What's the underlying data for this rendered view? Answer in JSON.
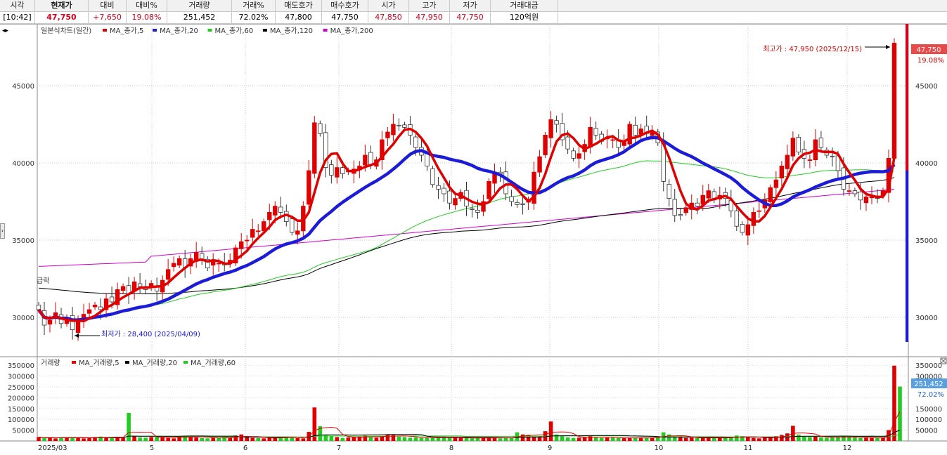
{
  "quote": {
    "headers": [
      "시각",
      "현재가",
      "대비",
      "대비%",
      "거래량",
      "거래%",
      "매도호가",
      "매수호가",
      "시가",
      "고가",
      "저가",
      "거래대금"
    ],
    "values": [
      "[10:42]",
      "47,750",
      "+7,650",
      "19.08%",
      "251,452",
      "72.02%",
      "47,800",
      "47,750",
      "47,850",
      "47,950",
      "47,750",
      "120억원"
    ]
  },
  "price_panel": {
    "legend_title": "일본식차트(일간)",
    "legend_items": [
      {
        "label": "MA_종가,5",
        "color": "#e00000"
      },
      {
        "label": "MA_종가,20",
        "color": "#1c1cd8"
      },
      {
        "label": "MA_종가,60",
        "color": "#22cc22"
      },
      {
        "label": "MA_종가,120",
        "color": "#000000"
      },
      {
        "label": "MA_종가,200",
        "color": "#d000d0"
      }
    ],
    "y_ticks": [
      "30000",
      "35000",
      "40000",
      "45000"
    ],
    "high_annotation": "최고가 : 47,950 (2025/12/15)",
    "low_annotation": "최저가 : 28,400 (2025/04/09)",
    "last_price_tag": "47,750",
    "last_change_tag": "19.08%",
    "side_text": "급락"
  },
  "volume_panel": {
    "legend_title": "거래량",
    "legend_items": [
      {
        "label": "MA_거래량,5",
        "color": "#e00000"
      },
      {
        "label": "MA_거래량,20",
        "color": "#000000"
      },
      {
        "label": "MA_거래량,60",
        "color": "#22cc22"
      }
    ],
    "y_ticks": [
      "50000",
      "100000",
      "150000",
      "200000",
      "250000",
      "300000",
      "350000"
    ],
    "right_ticks": [
      "50000",
      "100000",
      "150000",
      "300000",
      "350000"
    ],
    "last_volume_tag": "251,452",
    "last_ratio_tag": "72.02%"
  },
  "x_axis": {
    "labels": [
      "2025/03",
      "5",
      "6",
      "7",
      "8",
      "9",
      "10",
      "11",
      "12"
    ]
  },
  "chart_data": {
    "type": "candlestick",
    "price_ylim": [
      27500,
      49000
    ],
    "volume_ylim": [
      0,
      370000
    ],
    "closes": [
      30500,
      29500,
      29800,
      30300,
      29600,
      30000,
      29200,
      29800,
      30200,
      30500,
      30800,
      30500,
      31200,
      31000,
      31800,
      32000,
      31500,
      32300,
      32000,
      31800,
      32200,
      31700,
      32400,
      33100,
      33500,
      33800,
      33200,
      33800,
      34200,
      33700,
      33200,
      33600,
      33500,
      33400,
      33700,
      34500,
      34900,
      35000,
      35700,
      35600,
      36200,
      36800,
      37200,
      36800,
      36200,
      35500,
      35600,
      37200,
      39500,
      42600,
      41900,
      39700,
      39200,
      39700,
      39300,
      39500,
      39600,
      39800,
      40500,
      39900,
      40200,
      41500,
      42000,
      42500,
      42400,
      42300,
      41800,
      41000,
      40500,
      39800,
      38600,
      38300,
      38000,
      37400,
      37700,
      38100,
      37200,
      37000,
      36800,
      37500,
      38800,
      39400,
      39300,
      38000,
      37500,
      37300,
      37300,
      37500,
      39400,
      40400,
      41800,
      42800,
      42500,
      41500,
      40900,
      40300,
      40600,
      41200,
      42300,
      41800,
      41400,
      41600,
      41500,
      41000,
      41400,
      42500,
      41800,
      42200,
      41900,
      42000,
      41300,
      38800,
      37700,
      36600,
      36600,
      37100,
      37400,
      37200,
      37900,
      38200,
      37600,
      37900,
      37700,
      36900,
      35900,
      35500,
      36000,
      36800,
      36900,
      37600,
      38400,
      38900,
      39800,
      40500,
      41600,
      40700,
      40300,
      40200,
      41500,
      41000,
      40500,
      40400,
      39500,
      38300,
      38200,
      38000,
      37600,
      37800,
      37800,
      37700,
      38200,
      40300,
      47750
    ],
    "volumes": [
      18000,
      14000,
      15000,
      12000,
      16000,
      17000,
      14000,
      15000,
      12000,
      15000,
      18000,
      20000,
      17000,
      15000,
      19000,
      14000,
      130000,
      22000,
      16000,
      15000,
      18000,
      20000,
      17000,
      14000,
      12000,
      19000,
      24000,
      22000,
      16000,
      13000,
      12000,
      15000,
      14000,
      17000,
      16000,
      25000,
      30000,
      18000,
      14000,
      13000,
      12000,
      14000,
      16000,
      18000,
      20000,
      14000,
      13000,
      12000,
      42000,
      155000,
      68000,
      30000,
      22000,
      18000,
      14000,
      16000,
      18000,
      20000,
      25000,
      17000,
      15000,
      22000,
      30000,
      28000,
      20000,
      18000,
      15000,
      16000,
      14000,
      15000,
      14000,
      16000,
      17000,
      14000,
      15000,
      14000,
      13000,
      12000,
      14000,
      15000,
      16000,
      14000,
      12000,
      14000,
      16000,
      40000,
      30000,
      28000,
      18000,
      22000,
      45000,
      90000,
      30000,
      22000,
      16000,
      14000,
      15000,
      18000,
      22000,
      17000,
      14000,
      15000,
      16000,
      14000,
      13000,
      14000,
      15000,
      16000,
      14000,
      13000,
      18000,
      40000,
      30000,
      18000,
      16000,
      14000,
      15000,
      13000,
      14000,
      16000,
      15000,
      13000,
      14000,
      18000,
      25000,
      22000,
      16000,
      14000,
      12000,
      15000,
      18000,
      22000,
      28000,
      35000,
      70000,
      30000,
      22000,
      18000,
      20000,
      17000,
      15000,
      16000,
      18000,
      22000,
      20000,
      16000,
      14000,
      15000,
      14000,
      13000,
      16000,
      50000,
      348000,
      251452
    ]
  }
}
